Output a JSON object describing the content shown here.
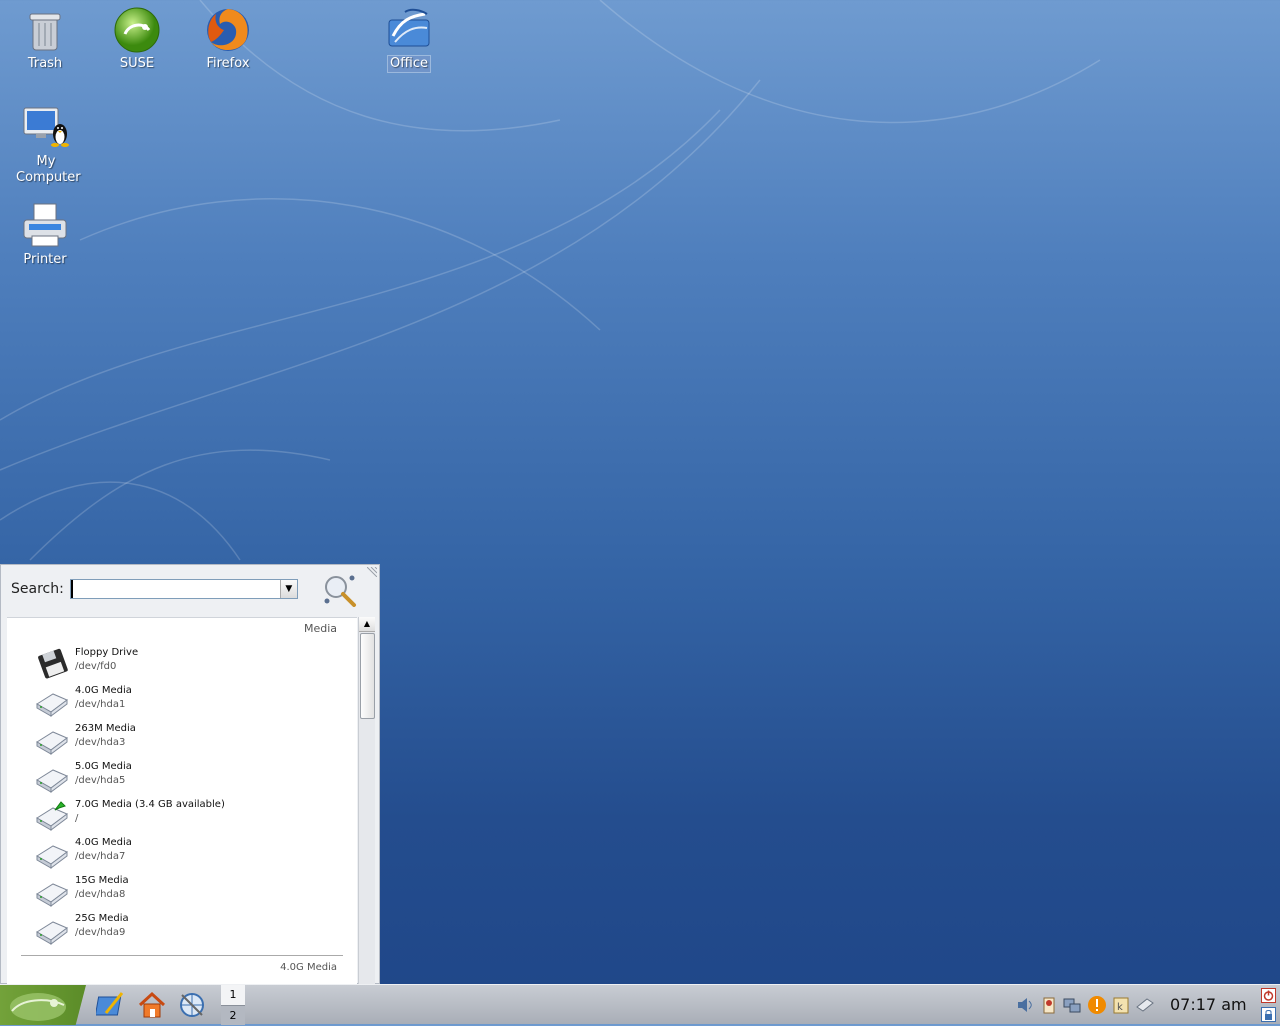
{
  "desktop": {
    "icons": [
      {
        "id": "trash",
        "label": "Trash"
      },
      {
        "id": "suse",
        "label": "SUSE"
      },
      {
        "id": "firefox",
        "label": "Firefox"
      },
      {
        "id": "office",
        "label": "Office"
      },
      {
        "id": "my-computer",
        "label": "My Computer"
      },
      {
        "id": "printer",
        "label": "Printer"
      }
    ]
  },
  "menu": {
    "search_label": "Search:",
    "search_value": "",
    "section_header": "Media",
    "items": [
      {
        "title": "Floppy Drive",
        "subtitle": "/dev/fd0",
        "icon": "floppy-icon"
      },
      {
        "title": "4.0G Media",
        "subtitle": "/dev/hda1",
        "icon": "hard-disk-icon"
      },
      {
        "title": "263M Media",
        "subtitle": "/dev/hda3",
        "icon": "hard-disk-icon"
      },
      {
        "title": "5.0G Media",
        "subtitle": "/dev/hda5",
        "icon": "hard-disk-icon"
      },
      {
        "title": "7.0G Media (3.4 GB available)",
        "subtitle": "/",
        "icon": "mounted-hard-disk-icon"
      },
      {
        "title": "4.0G Media",
        "subtitle": "/dev/hda7",
        "icon": "hard-disk-icon"
      },
      {
        "title": "15G Media",
        "subtitle": "/dev/hda8",
        "icon": "hard-disk-icon"
      },
      {
        "title": "25G Media",
        "subtitle": "/dev/hda9",
        "icon": "hard-disk-icon"
      }
    ],
    "footer_label": "4.0G Media"
  },
  "taskbar": {
    "pager": [
      "1",
      "2"
    ],
    "clock": "07:17 am",
    "tray_icons": [
      "volume-icon",
      "klipper-icon",
      "network-icon",
      "update-alert-icon",
      "kde-icon",
      "removable-media-icon"
    ]
  },
  "colors": {
    "accent": "#6ba336",
    "selection": "#7f9db9",
    "desktop_top": "#6f9bd0",
    "desktop_bottom": "#1f4688"
  }
}
